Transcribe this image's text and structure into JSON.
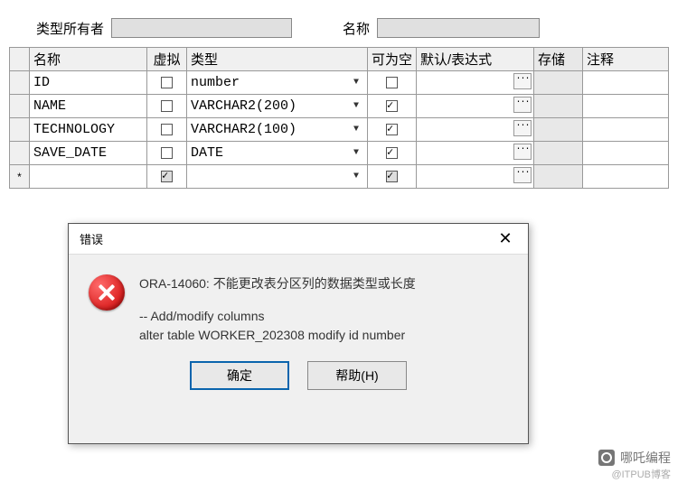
{
  "filters": {
    "owner_label": "类型所有者",
    "owner_value": "",
    "name_label": "名称",
    "name_value": ""
  },
  "grid": {
    "headers": {
      "name": "名称",
      "virtual": "虚拟",
      "type": "类型",
      "nullable": "可为空",
      "default": "默认/表达式",
      "store": "存储",
      "comment": "注释"
    },
    "rows": [
      {
        "name": "ID",
        "virtual": false,
        "type": "number",
        "nullable": false
      },
      {
        "name": "NAME",
        "virtual": false,
        "type": "VARCHAR2(200)",
        "nullable": true
      },
      {
        "name": "TECHNOLOGY",
        "virtual": false,
        "type": "VARCHAR2(100)",
        "nullable": true
      },
      {
        "name": "SAVE_DATE",
        "virtual": false,
        "type": "DATE",
        "nullable": true
      }
    ],
    "newrow_marker": "*"
  },
  "dialog": {
    "title": "错误",
    "message": "ORA-14060: 不能更改表分区列的数据类型或长度",
    "sub1": "-- Add/modify columns",
    "sub2": "alter table WORKER_202308 modify id number",
    "btn_ok": "确定",
    "btn_help": "帮助(H)"
  },
  "watermark": {
    "text": "哪吒编程",
    "sub": "@ITPUB博客"
  }
}
